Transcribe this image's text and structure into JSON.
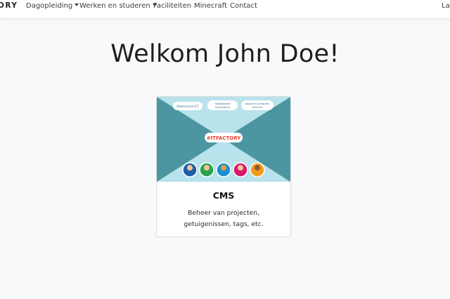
{
  "nav": {
    "brand": "ORY",
    "items": [
      {
        "label": "Dagopleiding",
        "dropdown": true
      },
      {
        "label": "Werken en studeren",
        "dropdown": true
      },
      {
        "label": "Faciliteiten",
        "dropdown": false
      },
      {
        "label": "Minecraft",
        "dropdown": false
      },
      {
        "label": "Contact",
        "dropdown": false
      }
    ],
    "right_label": "La"
  },
  "main": {
    "title": "Welkom John Doe!"
  },
  "card": {
    "title": "CMS",
    "text": "Beheer van projecten, getuigenissen, tags, etc.",
    "image": {
      "badges": [
        "Elektronica-ICT",
        "Toegepaste Informatica",
        "Applied Computer Science"
      ],
      "banner": "#ITFACTORY"
    }
  },
  "colors": {
    "background": "#f8f9fa",
    "teal_dark": "#4b96a0",
    "teal_light": "#b8e2ec",
    "banner_red": "#e8412d",
    "circles": [
      "#1d5fa8",
      "#2aa54c",
      "#1d8fd0",
      "#d81a6b",
      "#f39c1c"
    ]
  }
}
